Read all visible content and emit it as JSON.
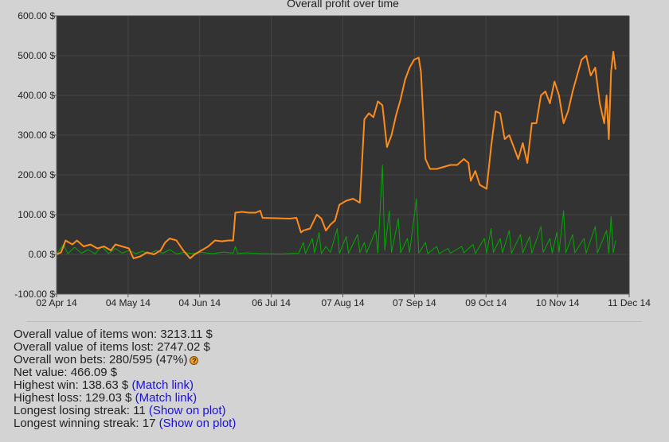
{
  "chart_data": {
    "type": "line",
    "title": "Overall profit over time",
    "xlabel": "",
    "ylabel": "",
    "x_ticks": [
      "02 Apr 14",
      "04 May 14",
      "04 Jun 14",
      "06 Jul 14",
      "07 Aug 14",
      "07 Sep 14",
      "09 Oct 14",
      "10 Nov 14",
      "11 Dec 14"
    ],
    "y_ticks": [
      "-100.00 $",
      "0.00 $",
      "100.00 $",
      "200.00 $",
      "300.00 $",
      "400.00 $",
      "500.00 $",
      "600.00 $"
    ],
    "xlim": [
      "2014-04-02",
      "2014-12-11"
    ],
    "ylim": [
      -100,
      600
    ],
    "grid": true,
    "colors": {
      "plot_bg": "#333333",
      "grid": "#444444",
      "profit": "#ff8c1a",
      "bets": "#00aa00"
    },
    "series": [
      {
        "color": "#ff8c1a",
        "points": [
          [
            "2014-04-02",
            0
          ],
          [
            "2014-04-04",
            5
          ],
          [
            "2014-04-06",
            35
          ],
          [
            "2014-04-09",
            25
          ],
          [
            "2014-04-11",
            35
          ],
          [
            "2014-04-14",
            20
          ],
          [
            "2014-04-17",
            25
          ],
          [
            "2014-04-20",
            15
          ],
          [
            "2014-04-23",
            20
          ],
          [
            "2014-04-26",
            10
          ],
          [
            "2014-04-28",
            25
          ],
          [
            "2014-05-01",
            20
          ],
          [
            "2014-05-04",
            15
          ],
          [
            "2014-05-06",
            -10
          ],
          [
            "2014-05-09",
            -5
          ],
          [
            "2014-05-12",
            5
          ],
          [
            "2014-05-15",
            0
          ],
          [
            "2014-05-18",
            10
          ],
          [
            "2014-05-20",
            30
          ],
          [
            "2014-05-22",
            40
          ],
          [
            "2014-05-25",
            35
          ],
          [
            "2014-05-28",
            10
          ],
          [
            "2014-05-31",
            -10
          ],
          [
            "2014-06-02",
            0
          ],
          [
            "2014-06-05",
            10
          ],
          [
            "2014-06-08",
            20
          ],
          [
            "2014-06-11",
            35
          ],
          [
            "2014-06-14",
            33
          ],
          [
            "2014-06-17",
            35
          ],
          [
            "2014-06-19",
            35
          ],
          [
            "2014-06-20",
            105
          ],
          [
            "2014-06-23",
            107
          ],
          [
            "2014-06-26",
            105
          ],
          [
            "2014-06-29",
            105
          ],
          [
            "2014-07-01",
            110
          ],
          [
            "2014-07-02",
            92
          ],
          [
            "2014-07-08",
            91
          ],
          [
            "2014-07-14",
            90
          ],
          [
            "2014-07-17",
            92
          ],
          [
            "2014-07-19",
            55
          ],
          [
            "2014-07-20",
            60
          ],
          [
            "2014-07-23",
            65
          ],
          [
            "2014-07-26",
            100
          ],
          [
            "2014-07-28",
            90
          ],
          [
            "2014-07-30",
            60
          ],
          [
            "2014-08-01",
            75
          ],
          [
            "2014-08-03",
            85
          ],
          [
            "2014-08-05",
            125
          ],
          [
            "2014-08-08",
            135
          ],
          [
            "2014-08-11",
            140
          ],
          [
            "2014-08-14",
            130
          ],
          [
            "2014-08-16",
            340
          ],
          [
            "2014-08-18",
            355
          ],
          [
            "2014-08-20",
            345
          ],
          [
            "2014-08-22",
            385
          ],
          [
            "2014-08-24",
            375
          ],
          [
            "2014-08-26",
            270
          ],
          [
            "2014-08-28",
            300
          ],
          [
            "2014-08-30",
            350
          ],
          [
            "2014-09-01",
            390
          ],
          [
            "2014-09-03",
            440
          ],
          [
            "2014-09-05",
            470
          ],
          [
            "2014-09-07",
            490
          ],
          [
            "2014-09-09",
            495
          ],
          [
            "2014-09-10",
            460
          ],
          [
            "2014-09-12",
            240
          ],
          [
            "2014-09-14",
            215
          ],
          [
            "2014-09-17",
            215
          ],
          [
            "2014-09-20",
            220
          ],
          [
            "2014-09-23",
            225
          ],
          [
            "2014-09-26",
            225
          ],
          [
            "2014-09-29",
            240
          ],
          [
            "2014-10-01",
            230
          ],
          [
            "2014-10-02",
            185
          ],
          [
            "2014-10-04",
            210
          ],
          [
            "2014-10-06",
            175
          ],
          [
            "2014-10-09",
            165
          ],
          [
            "2014-10-11",
            270
          ],
          [
            "2014-10-13",
            360
          ],
          [
            "2014-10-15",
            355
          ],
          [
            "2014-10-17",
            290
          ],
          [
            "2014-10-19",
            300
          ],
          [
            "2014-10-21",
            270
          ],
          [
            "2014-10-23",
            240
          ],
          [
            "2014-10-25",
            280
          ],
          [
            "2014-10-27",
            230
          ],
          [
            "2014-10-29",
            330
          ],
          [
            "2014-10-31",
            330
          ],
          [
            "2014-11-02",
            400
          ],
          [
            "2014-11-04",
            410
          ],
          [
            "2014-11-06",
            380
          ],
          [
            "2014-11-08",
            435
          ],
          [
            "2014-11-10",
            400
          ],
          [
            "2014-11-12",
            330
          ],
          [
            "2014-11-14",
            360
          ],
          [
            "2014-11-16",
            410
          ],
          [
            "2014-11-18",
            450
          ],
          [
            "2014-11-20",
            490
          ],
          [
            "2014-11-22",
            500
          ],
          [
            "2014-11-24",
            450
          ],
          [
            "2014-11-26",
            470
          ],
          [
            "2014-11-28",
            380
          ],
          [
            "2014-11-30",
            330
          ],
          [
            "2014-12-01",
            400
          ],
          [
            "2014-12-02",
            290
          ],
          [
            "2014-12-03",
            460
          ],
          [
            "2014-12-04",
            510
          ],
          [
            "2014-12-05",
            465
          ]
        ]
      },
      {
        "color": "#00aa00",
        "points": [
          [
            "2014-04-02",
            0
          ],
          [
            "2014-04-05",
            25
          ],
          [
            "2014-04-07",
            2
          ],
          [
            "2014-04-10",
            18
          ],
          [
            "2014-04-13",
            3
          ],
          [
            "2014-04-16",
            12
          ],
          [
            "2014-04-19",
            1
          ],
          [
            "2014-04-22",
            20
          ],
          [
            "2014-04-25",
            2
          ],
          [
            "2014-04-28",
            15
          ],
          [
            "2014-05-01",
            3
          ],
          [
            "2014-05-04",
            10
          ],
          [
            "2014-05-07",
            2
          ],
          [
            "2014-05-10",
            8
          ],
          [
            "2014-05-13",
            1
          ],
          [
            "2014-05-16",
            10
          ],
          [
            "2014-05-19",
            3
          ],
          [
            "2014-05-22",
            12
          ],
          [
            "2014-05-25",
            1
          ],
          [
            "2014-05-28",
            5
          ],
          [
            "2014-06-01",
            2
          ],
          [
            "2014-06-05",
            5
          ],
          [
            "2014-06-10",
            2
          ],
          [
            "2014-06-15",
            6
          ],
          [
            "2014-06-19",
            3
          ],
          [
            "2014-06-20",
            20
          ],
          [
            "2014-06-21",
            2
          ],
          [
            "2014-06-25",
            4
          ],
          [
            "2014-07-01",
            2
          ],
          [
            "2014-07-10",
            1
          ],
          [
            "2014-07-18",
            3
          ],
          [
            "2014-07-20",
            30
          ],
          [
            "2014-07-21",
            2
          ],
          [
            "2014-07-24",
            40
          ],
          [
            "2014-07-25",
            3
          ],
          [
            "2014-07-27",
            55
          ],
          [
            "2014-07-28",
            2
          ],
          [
            "2014-07-30",
            20
          ],
          [
            "2014-08-01",
            5
          ],
          [
            "2014-08-04",
            65
          ],
          [
            "2014-08-05",
            3
          ],
          [
            "2014-08-08",
            45
          ],
          [
            "2014-08-09",
            3
          ],
          [
            "2014-08-13",
            50
          ],
          [
            "2014-08-14",
            5
          ],
          [
            "2014-08-16",
            30
          ],
          [
            "2014-08-17",
            4
          ],
          [
            "2014-08-21",
            60
          ],
          [
            "2014-08-22",
            4
          ],
          [
            "2014-08-24",
            225
          ],
          [
            "2014-08-25",
            10
          ],
          [
            "2014-08-27",
            110
          ],
          [
            "2014-08-28",
            5
          ],
          [
            "2014-08-31",
            90
          ],
          [
            "2014-09-01",
            4
          ],
          [
            "2014-09-04",
            40
          ],
          [
            "2014-09-05",
            5
          ],
          [
            "2014-09-08",
            140
          ],
          [
            "2014-09-09",
            3
          ],
          [
            "2014-09-12",
            30
          ],
          [
            "2014-09-13",
            2
          ],
          [
            "2014-09-17",
            20
          ],
          [
            "2014-09-18",
            2
          ],
          [
            "2014-09-22",
            15
          ],
          [
            "2014-09-23",
            3
          ],
          [
            "2014-09-28",
            20
          ],
          [
            "2014-09-29",
            4
          ],
          [
            "2014-10-03",
            25
          ],
          [
            "2014-10-04",
            2
          ],
          [
            "2014-10-08",
            40
          ],
          [
            "2014-10-09",
            3
          ],
          [
            "2014-10-11",
            65
          ],
          [
            "2014-10-12",
            5
          ],
          [
            "2014-10-15",
            40
          ],
          [
            "2014-10-16",
            4
          ],
          [
            "2014-10-19",
            60
          ],
          [
            "2014-10-20",
            3
          ],
          [
            "2014-10-24",
            50
          ],
          [
            "2014-10-25",
            4
          ],
          [
            "2014-10-28",
            45
          ],
          [
            "2014-10-29",
            3
          ],
          [
            "2014-11-02",
            70
          ],
          [
            "2014-11-03",
            5
          ],
          [
            "2014-11-06",
            40
          ],
          [
            "2014-11-07",
            3
          ],
          [
            "2014-11-09",
            55
          ],
          [
            "2014-11-10",
            5
          ],
          [
            "2014-11-12",
            110
          ],
          [
            "2014-11-13",
            4
          ],
          [
            "2014-11-16",
            50
          ],
          [
            "2014-11-17",
            4
          ],
          [
            "2014-11-21",
            40
          ],
          [
            "2014-11-22",
            3
          ],
          [
            "2014-11-26",
            70
          ],
          [
            "2014-11-27",
            4
          ],
          [
            "2014-12-01",
            60
          ],
          [
            "2014-12-02",
            3
          ],
          [
            "2014-12-03",
            95
          ],
          [
            "2014-12-04",
            4
          ],
          [
            "2014-12-05",
            35
          ]
        ]
      }
    ]
  },
  "stats": [
    {
      "text": "Overall value of items won: 3213.11 $"
    },
    {
      "text": "Overall value of items lost: 2747.02 $"
    },
    {
      "text": "Overall won bets: 280/595 (47%)",
      "help": "?"
    },
    {
      "text": "Net value: 466.09 $"
    },
    {
      "text": "Highest win: 138.63 $ ",
      "link": "(Match link)"
    },
    {
      "text": "Highest loss: 129.03 $ ",
      "link": "(Match link)"
    },
    {
      "text": "Longest losing streak: 11 ",
      "link": "(Show on plot)"
    },
    {
      "text": "Longest winning streak: 17 ",
      "link": "(Show on plot)"
    }
  ]
}
